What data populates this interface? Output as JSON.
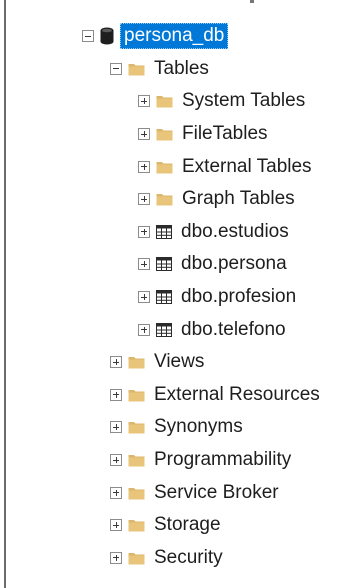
{
  "tree": {
    "database": {
      "label": "persona_db",
      "expanded": true,
      "selected": true,
      "icon": "database-icon"
    },
    "tables": {
      "label": "Tables",
      "expanded": true,
      "icon": "folder-icon"
    },
    "table_children": [
      {
        "label": "System Tables",
        "type": "folder",
        "icon": "folder-icon"
      },
      {
        "label": "FileTables",
        "type": "folder",
        "icon": "folder-icon"
      },
      {
        "label": "External Tables",
        "type": "folder",
        "icon": "folder-icon"
      },
      {
        "label": "Graph Tables",
        "type": "folder",
        "icon": "folder-icon"
      },
      {
        "label": "dbo.estudios",
        "type": "table",
        "icon": "table-icon"
      },
      {
        "label": "dbo.persona",
        "type": "table",
        "icon": "table-icon"
      },
      {
        "label": "dbo.profesion",
        "type": "table",
        "icon": "table-icon"
      },
      {
        "label": "dbo.telefono",
        "type": "table",
        "icon": "table-icon"
      }
    ],
    "db_folders": [
      {
        "label": "Views",
        "icon": "folder-icon"
      },
      {
        "label": "External Resources",
        "icon": "folder-icon"
      },
      {
        "label": "Synonyms",
        "icon": "folder-icon"
      },
      {
        "label": "Programmability",
        "icon": "folder-icon"
      },
      {
        "label": "Service Broker",
        "icon": "folder-icon"
      },
      {
        "label": "Storage",
        "icon": "folder-icon"
      },
      {
        "label": "Security",
        "icon": "folder-icon"
      }
    ]
  },
  "colors": {
    "selection": "#0078d7",
    "folder": "#dcb66a",
    "database": "#1e1e1e"
  }
}
